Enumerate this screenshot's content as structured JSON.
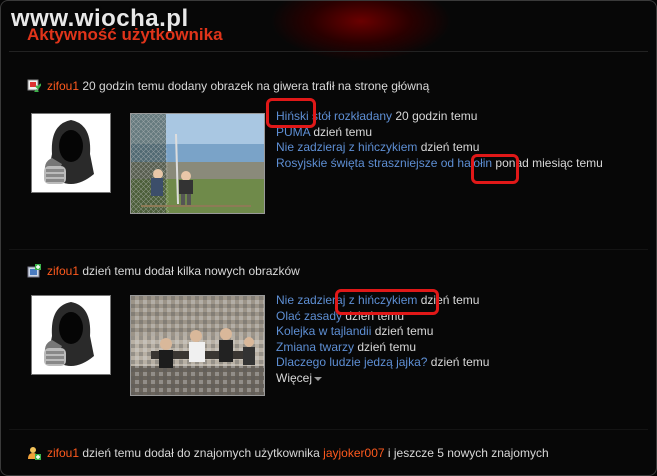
{
  "watermark": "www.wiocha.pl",
  "section_title": "Aktywność użytkownika",
  "events": [
    {
      "icon": "picture-upload-icon",
      "user": "zifou1",
      "text": " 20 godzin temu dodany obrazek na giwera trafił na stronę główną",
      "items": [
        {
          "title": "Hiński stół rozkładany",
          "time": " 20 godzin temu"
        },
        {
          "title": "PUMA",
          "time": " dzień temu"
        },
        {
          "title": "Nie zadzieraj z hińczykiem",
          "time": " dzień temu"
        },
        {
          "title": "Rosyjskie święta straszniejsze od halołin",
          "time": " ponad miesiąc temu"
        }
      ]
    },
    {
      "icon": "add-pictures-icon",
      "user": "zifou1",
      "text": " dzień temu dodał kilka nowych obrazków",
      "items": [
        {
          "title": "Nie zadzieraj z hińczykiem",
          "time": " dzień temu"
        },
        {
          "title": "Olać zasady",
          "time": " dzień temu"
        },
        {
          "title": "Kolejka w tajlandii",
          "time": " dzień temu"
        },
        {
          "title": "Zmiana twarzy",
          "time": " dzień temu"
        },
        {
          "title": "Dlaczego ludzie jedzą jajka?",
          "time": " dzień temu"
        }
      ],
      "more": "Więcej"
    },
    {
      "icon": "add-friend-icon",
      "user": "zifou1",
      "text": " dzień temu dodał do znajomych użytkownika ",
      "friend": "jayjoker007",
      "text2": " i jeszcze 5 nowych znajomych"
    }
  ],
  "colors": {
    "user": "#ff5a1e",
    "link": "#5e8fd4",
    "title": "#e0341a",
    "highlight": "#e01818"
  }
}
